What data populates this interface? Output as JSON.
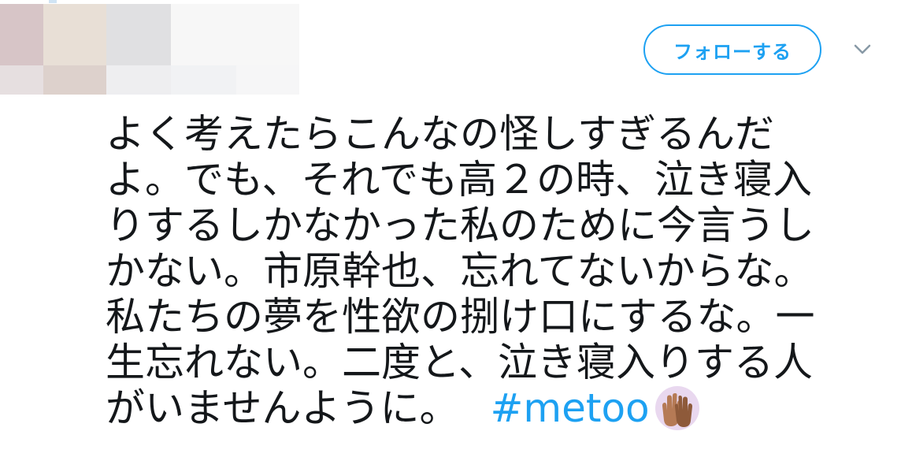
{
  "header": {
    "follow_label": "フォローする",
    "caret_icon": "chevron-down-icon"
  },
  "tweet": {
    "lines": [
      "よく考えたらこんなの怪しすぎるんだ",
      "よ。でも、それでも高２の時、泣き寝入",
      "りするしかなかった私のために今言うし",
      "かない。市原幹也、忘れてないからな。",
      "私たちの夢を性欲の捌け口にするな。一",
      "生忘れない。二度と、泣き寝入りする人",
      "がいませんように。"
    ],
    "hashtag": "#metoo",
    "emoji": "raised-hands-icon"
  },
  "colors": {
    "accent": "#1da1f2",
    "text": "#14171a"
  }
}
